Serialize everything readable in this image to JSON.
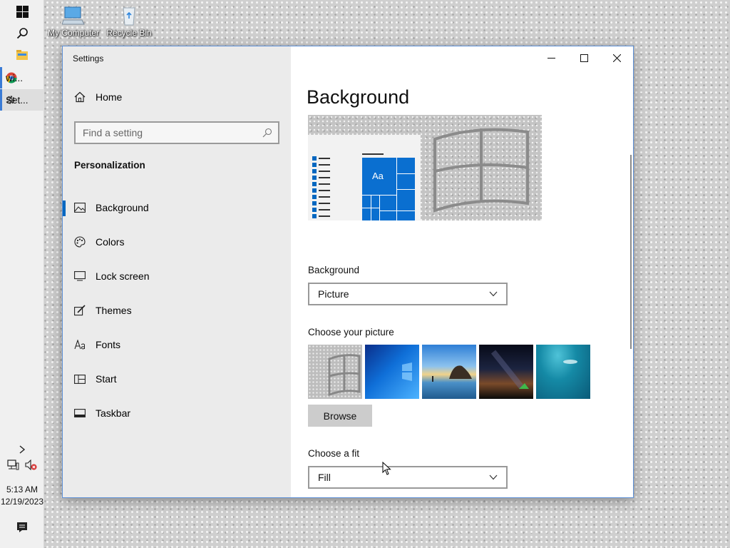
{
  "taskbar": {
    "apps": [
      {
        "label": "wi...",
        "icon": "chrome-icon"
      },
      {
        "label": "Set...",
        "icon": "gear-icon"
      }
    ],
    "clock": {
      "time": "5:13 AM",
      "date": "12/19/2023"
    }
  },
  "desktop": {
    "icons": [
      {
        "label": "My Computer",
        "icon": "computer-icon"
      },
      {
        "label": "Recycle Bin",
        "icon": "recycle-bin-icon"
      }
    ]
  },
  "window": {
    "title": "Settings",
    "controls": [
      "minimize",
      "maximize",
      "close"
    ]
  },
  "sidebar": {
    "home_label": "Home",
    "search_placeholder": "Find a setting",
    "section_title": "Personalization",
    "items": [
      {
        "label": "Background",
        "icon": "picture-icon",
        "selected": true
      },
      {
        "label": "Colors",
        "icon": "palette-icon",
        "selected": false
      },
      {
        "label": "Lock screen",
        "icon": "lock-screen-icon",
        "selected": false
      },
      {
        "label": "Themes",
        "icon": "themes-icon",
        "selected": false
      },
      {
        "label": "Fonts",
        "icon": "fonts-icon",
        "selected": false
      },
      {
        "label": "Start",
        "icon": "start-icon",
        "selected": false
      },
      {
        "label": "Taskbar",
        "icon": "taskbar-icon",
        "selected": false
      }
    ]
  },
  "content": {
    "page_title": "Background",
    "preview_tile_text": "Aa",
    "background_label": "Background",
    "background_value": "Picture",
    "choose_picture_label": "Choose your picture",
    "browse_label": "Browse",
    "fit_label": "Choose a fit",
    "fit_value": "Fill"
  },
  "colors": {
    "accent": "#0067c0",
    "tile_blue": "#0a6fd0"
  }
}
